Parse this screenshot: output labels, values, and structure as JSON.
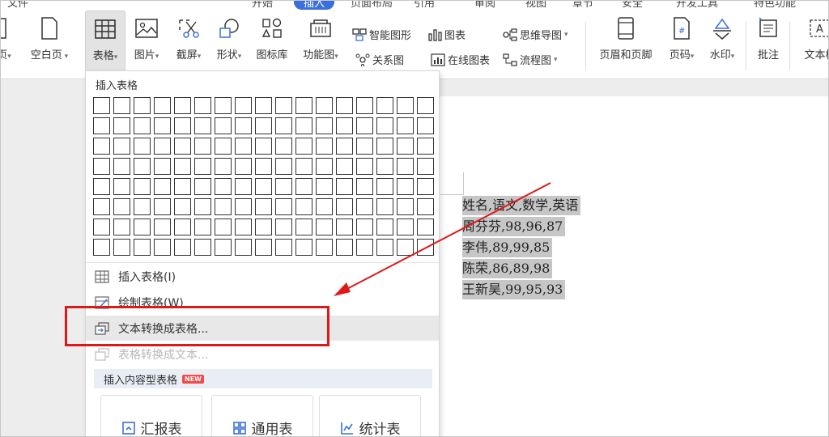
{
  "menubar": {
    "items": [
      "文件",
      "开始",
      "插入",
      "页面布局",
      "引用",
      "审阅",
      "视图",
      "章节",
      "安全",
      "开发工具",
      "特色功能"
    ],
    "active": "插入"
  },
  "ribbon": {
    "page_label": "页",
    "blank_page": "空白页",
    "table": "表格",
    "picture": "图片",
    "screenshot": "截屏",
    "shape": "形状",
    "icon_lib": "图标库",
    "function_chart": "功能图",
    "smart_graphic": "智能图形",
    "chart": "图表",
    "mindmap": "思维导图",
    "relation_chart": "关系图",
    "online_chart": "在线图表",
    "flowchart": "流程图",
    "header_footer": "页眉和页脚",
    "page_number": "页码",
    "watermark": "水印",
    "comment": "批注",
    "textbox": "文本框"
  },
  "dropdown": {
    "title": "插入表格",
    "grid_rows": 8,
    "grid_cols": 17,
    "insert_table": "插入表格(I)",
    "draw_table": "绘制表格(W)",
    "text_to_table": "文本转换成表格...",
    "table_to_text": "表格转换成文本...",
    "content_section": "插入内容型表格",
    "new_badge": "NEW",
    "cards": [
      "汇报表",
      "通用表",
      "统计表"
    ]
  },
  "document": {
    "lines": [
      "姓名,语文,数学,英语",
      "周芬芬,98,96,87",
      "李伟,89,99,85",
      "陈荣,86,89,98",
      "王新昊,99,95,93"
    ]
  },
  "colors": {
    "accent": "#3b6fdc",
    "annotation": "#e01818",
    "selection": "#c6c6c6"
  }
}
